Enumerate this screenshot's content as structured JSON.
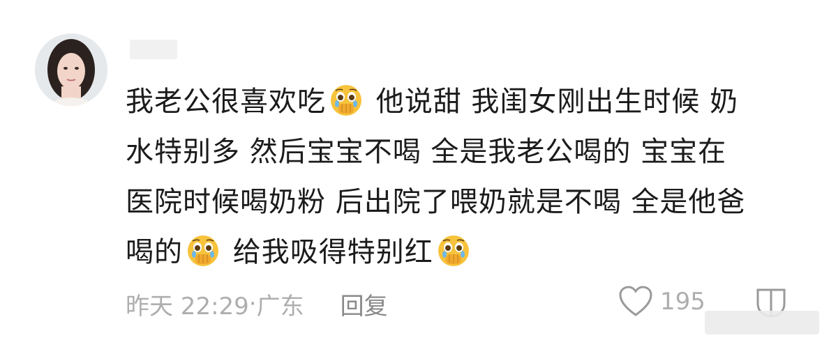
{
  "comment": {
    "lines": [
      [
        "我老公很喜欢吃",
        "emoji",
        " 他说甜 我闺女刚出生时候 奶"
      ],
      [
        "水特别多 然后宝宝不喝  全是我老公喝的 宝宝在"
      ],
      [
        "医院时候喝奶粉 后出院了喂奶就是不喝 全是他爸"
      ],
      [
        "喝的",
        "emoji",
        " 给我吸得特别红",
        "emoji"
      ]
    ],
    "emoji_icon": "crying-face-covering-mouth-icon"
  },
  "meta": {
    "time": "昨天 22:29",
    "separator": "·",
    "location": "广东",
    "reply_label": "回复",
    "like_count": "195"
  },
  "colors": {
    "text": "#1b1b1b",
    "meta": "#aeaeae",
    "emoji_face": "#f7c33c"
  }
}
